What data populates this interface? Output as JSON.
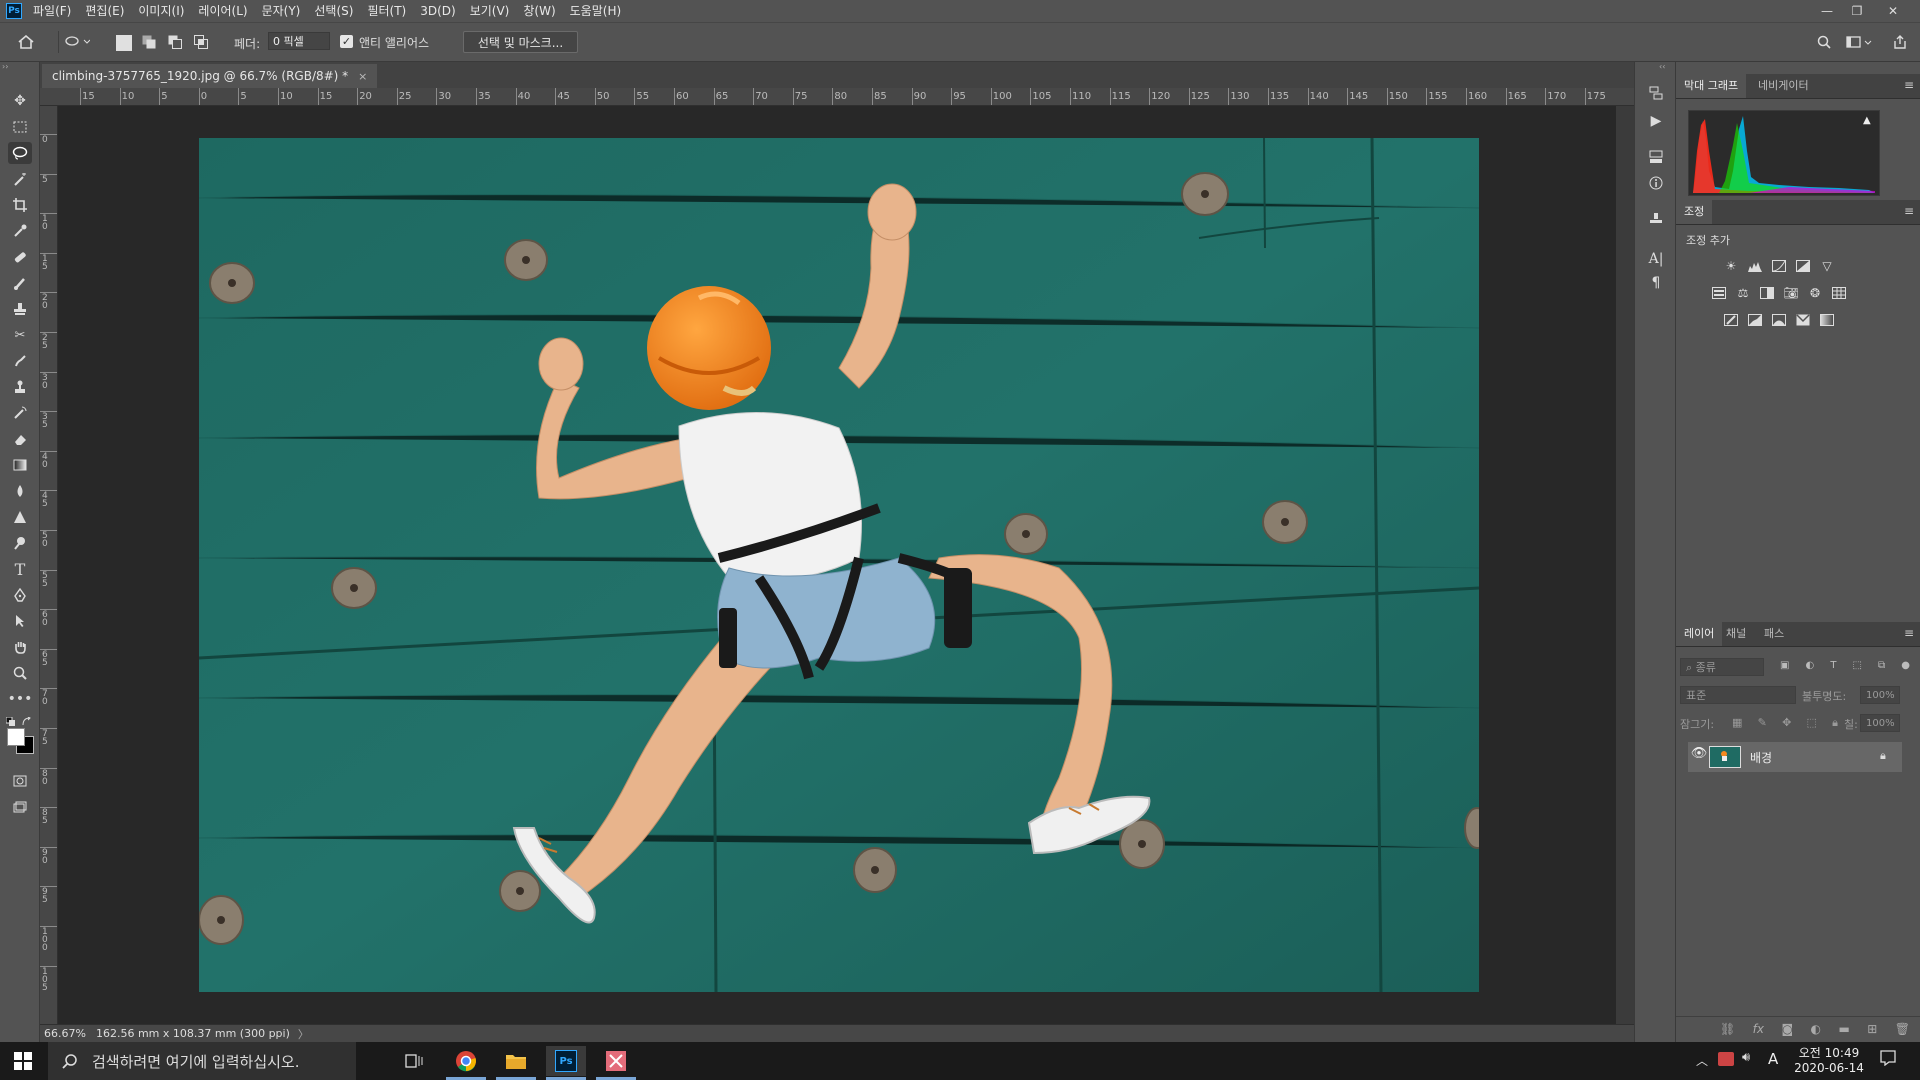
{
  "app": {
    "logo": "Ps"
  },
  "menu": [
    "파일(F)",
    "편집(E)",
    "이미지(I)",
    "레이어(L)",
    "문자(Y)",
    "선택(S)",
    "필터(T)",
    "3D(D)",
    "보기(V)",
    "창(W)",
    "도움말(H)"
  ],
  "window_controls": {
    "minimize": "—",
    "restore": "❐",
    "close": "✕"
  },
  "options": {
    "feather_label": "페더:",
    "feather_value": "0 픽셀",
    "antialias_label": "앤티 앨리어스",
    "antialias_checked": "✓",
    "select_mask_label": "선택 및 마스크..."
  },
  "document": {
    "tab_title": "climbing-3757765_1920.jpg @ 66.7% (RGB/8#) *",
    "tab_close": "×",
    "zoom": "66.67%",
    "dimensions": "162.56 mm x 108.37 mm (300 ppi)",
    "status_arrow": "〉"
  },
  "ruler_h": [
    "15",
    "10",
    "5",
    "0",
    "5",
    "10",
    "15",
    "20",
    "25",
    "30",
    "35",
    "40",
    "45",
    "50",
    "55",
    "60",
    "65",
    "70",
    "75",
    "80",
    "85",
    "90",
    "95",
    "100",
    "105",
    "110",
    "115",
    "120",
    "125",
    "130",
    "135",
    "140",
    "145",
    "150",
    "155",
    "160",
    "165",
    "170",
    "175"
  ],
  "ruler_v": [
    "0",
    "5",
    "1 0",
    "1 5",
    "2 0",
    "2 5",
    "3 0",
    "3 5",
    "4 0",
    "4 5",
    "5 0",
    "5 5",
    "6 0",
    "6 5",
    "7 0",
    "7 5",
    "8 0",
    "8 5",
    "9 0",
    "9 5",
    "1 0 0",
    "1 0 5"
  ],
  "panels": {
    "histogram_tabs": [
      "막대 그래프",
      "네비게이터"
    ],
    "adjust_tab": "조정",
    "adjust_add": "조정 추가",
    "layer_tabs": [
      "레이어",
      "채널",
      "패스"
    ],
    "layer_search_placeholder": "종류",
    "blend_mode": "표준",
    "opacity_label": "불투명도:",
    "opacity_value": "100%",
    "lock_label": "잠그기:",
    "fill_label": "칠:",
    "fill_value": "100%",
    "layer_name": "배경"
  },
  "taskbar": {
    "search_placeholder": "검색하려면 여기에 입력하십시오.",
    "ime": "A",
    "time": "오전 10:49",
    "date": "2020-06-14"
  },
  "colors": {
    "wall": "#1f6b63",
    "helmet": "#f5891f",
    "accent_blue": "#31a8ff"
  }
}
